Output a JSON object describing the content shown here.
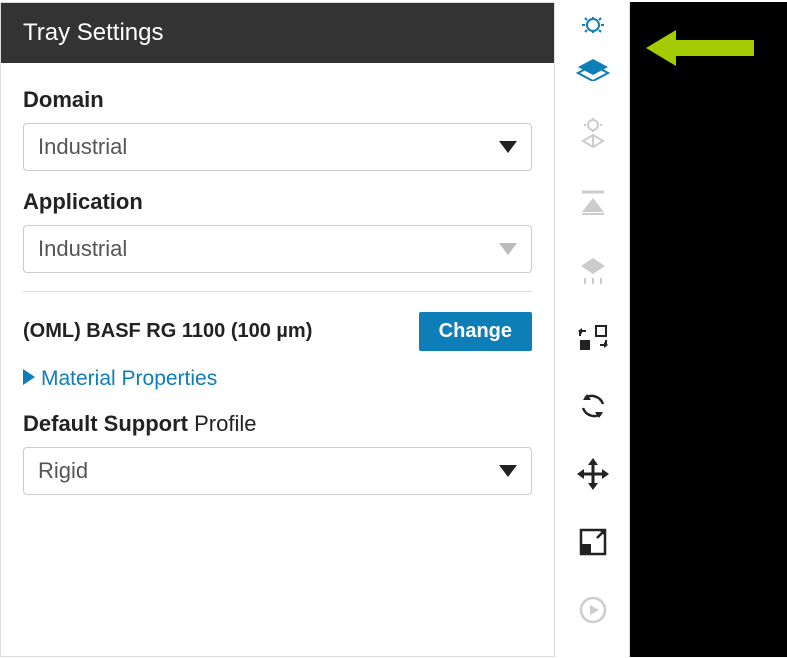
{
  "panel": {
    "title": "Tray Settings",
    "domain": {
      "label": "Domain",
      "value": "Industrial"
    },
    "application": {
      "label": "Application",
      "value": "Industrial"
    },
    "material": {
      "name": "(OML) BASF RG 1100 (100 µm)",
      "change_label": "Change",
      "properties_label": "Material Properties"
    },
    "support": {
      "label_bold": "Default Support",
      "label_rest": " Profile",
      "value": "Rigid"
    }
  },
  "toolbar": {
    "items": [
      {
        "name": "tray-settings-icon",
        "active": true
      },
      {
        "name": "model-settings-icon",
        "active": false
      },
      {
        "name": "orientation-icon",
        "active": false
      },
      {
        "name": "placement-icon",
        "active": false
      },
      {
        "name": "transform-icon",
        "active": true
      },
      {
        "name": "rotate-icon",
        "active": true
      },
      {
        "name": "move-icon",
        "active": true
      },
      {
        "name": "scale-icon",
        "active": true
      },
      {
        "name": "refresh-icon",
        "active": false
      }
    ]
  },
  "colors": {
    "accent": "#0d7eb8",
    "arrow": "#a3cc00",
    "header": "#333333"
  }
}
